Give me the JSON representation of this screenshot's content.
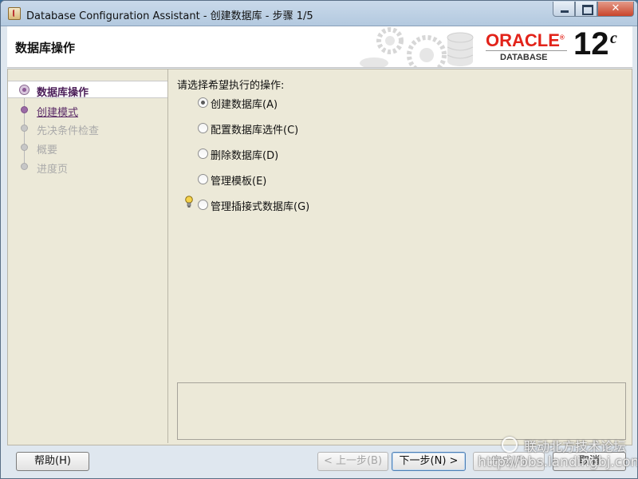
{
  "window": {
    "title": "Database Configuration Assistant - 创建数据库 - 步骤 1/5",
    "close_glyph": "✕"
  },
  "banner": {
    "title": "数据库操作",
    "logo_oracle": "ORACLE",
    "logo_registered": "®",
    "logo_database": "DATABASE",
    "logo_version": "12",
    "logo_version_suffix": "c"
  },
  "steps": [
    {
      "label": "数据库操作",
      "state": "active"
    },
    {
      "label": "创建模式",
      "state": "next"
    },
    {
      "label": "先决条件检查",
      "state": "disabled"
    },
    {
      "label": "概要",
      "state": "disabled"
    },
    {
      "label": "进度页",
      "state": "disabled"
    }
  ],
  "main": {
    "prompt": "请选择希望执行的操作:",
    "options": [
      {
        "label": "创建数据库(A)",
        "selected": true
      },
      {
        "label": "配置数据库选件(C)",
        "selected": false
      },
      {
        "label": "删除数据库(D)",
        "selected": false
      },
      {
        "label": "管理模板(E)",
        "selected": false
      },
      {
        "label": "管理插接式数据库(G)",
        "selected": false
      }
    ]
  },
  "buttons": {
    "help": "帮助(H)",
    "back": "< 上一步(B)",
    "next": "下一步(N) >",
    "finish": "完成(F)",
    "cancel": "取消"
  },
  "watermark": {
    "line1": "联动北方技术论坛",
    "line2": "http://bbs.landingbj.com"
  }
}
